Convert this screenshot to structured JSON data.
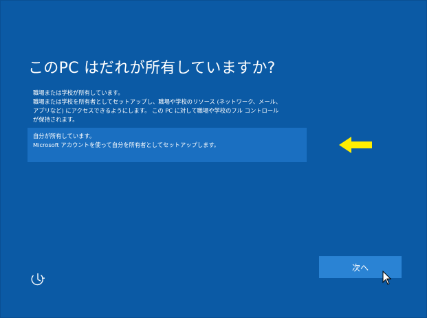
{
  "page": {
    "title": "このPC はだれが所有していますか?"
  },
  "options": {
    "work": {
      "lines": [
        "職場または学校が所有しています。",
        "職場または学校を所有者としてセットアップし、職場や学校のリソース (ネットワーク、メール、",
        "アプリなど) にアクセスできるようにします。 この PC に対して職場や学校のフル コントロール",
        "が保持されます。"
      ]
    },
    "personal": {
      "lines": [
        "自分が所有しています。",
        "Microsoft アカウントを使って自分を所有者としてセットアップします。"
      ]
    }
  },
  "buttons": {
    "next_label": "次へ"
  },
  "icons": {
    "accessibility": "accessibility-icon",
    "arrow": "arrow-left-icon",
    "cursor": "mouse-cursor-icon"
  },
  "colors": {
    "background": "#0b5aa5",
    "selected_option": "#1a6fc1",
    "button": "#2a83d4",
    "arrow": "#ffee00"
  }
}
